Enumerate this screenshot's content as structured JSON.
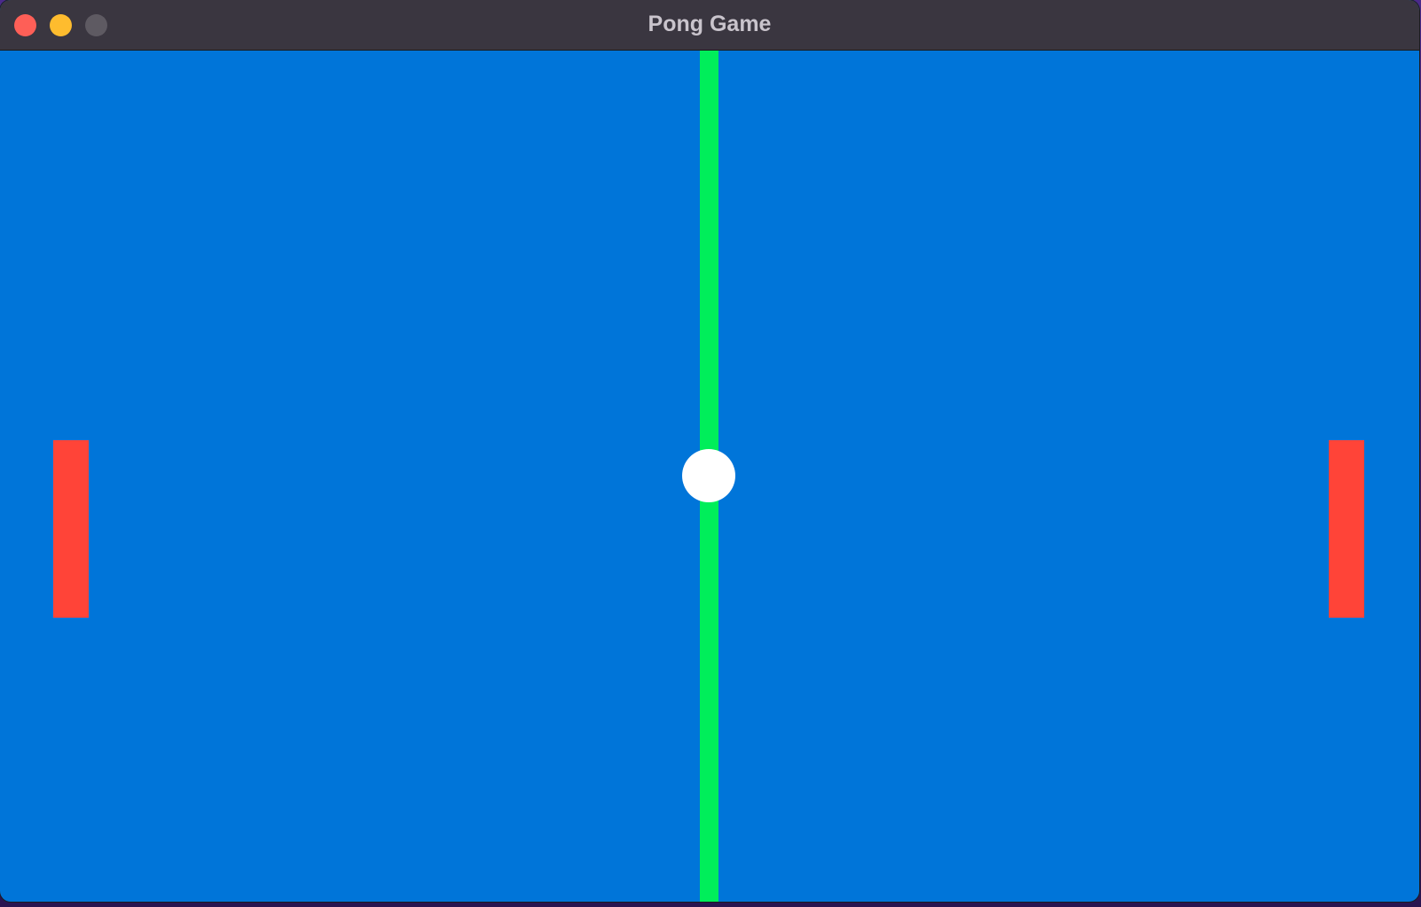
{
  "window": {
    "title": "Pong Game"
  },
  "colors": {
    "titlebar": "#3a3640",
    "close_button": "#fe5f57",
    "minimize_button": "#febc2e",
    "maximize_button": "#5e5a62",
    "field": "#0075d9",
    "net": "#00ee5a",
    "paddle": "#ff4438",
    "ball": "#ffffff"
  },
  "icons": {
    "close": "close-icon",
    "minimize": "minimize-icon",
    "maximize": "maximize-icon"
  }
}
